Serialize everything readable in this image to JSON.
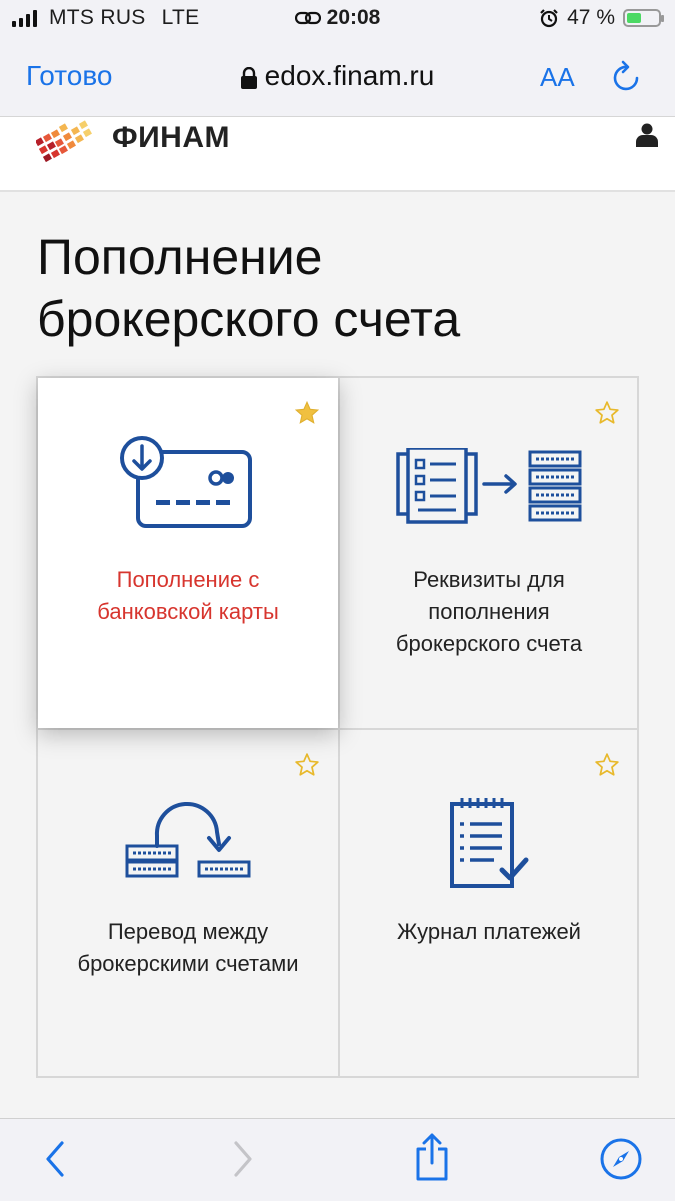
{
  "status_bar": {
    "carrier": "MTS RUS",
    "network": "LTE",
    "time": "20:08",
    "battery": "47 %"
  },
  "browser": {
    "done_label": "Готово",
    "url": "edox.finam.ru",
    "text_size_label": "AA"
  },
  "site": {
    "brand": "ФИНАМ"
  },
  "page": {
    "title_line1": "Пополнение",
    "title_line2": "брокерского счета"
  },
  "tiles": [
    {
      "label_line1": "Пополнение с",
      "label_line2": "банковской карты",
      "favorite": true,
      "icon": "card-download-icon"
    },
    {
      "label_line1": "Реквизиты для",
      "label_line2": "пополнения",
      "label_line3": "брокерского счета",
      "favorite": false,
      "icon": "requisites-transfer-icon"
    },
    {
      "label_line1": "Перевод между",
      "label_line2": "брокерскими счетами",
      "favorite": false,
      "icon": "account-transfer-icon"
    },
    {
      "label_line1": "Журнал платежей",
      "favorite": false,
      "icon": "payment-journal-icon"
    }
  ],
  "colors": {
    "accent_red": "#d7352e",
    "icon_blue": "#1e4f9c",
    "star_gold": "#f0c040",
    "ios_blue": "#1a73e8"
  }
}
